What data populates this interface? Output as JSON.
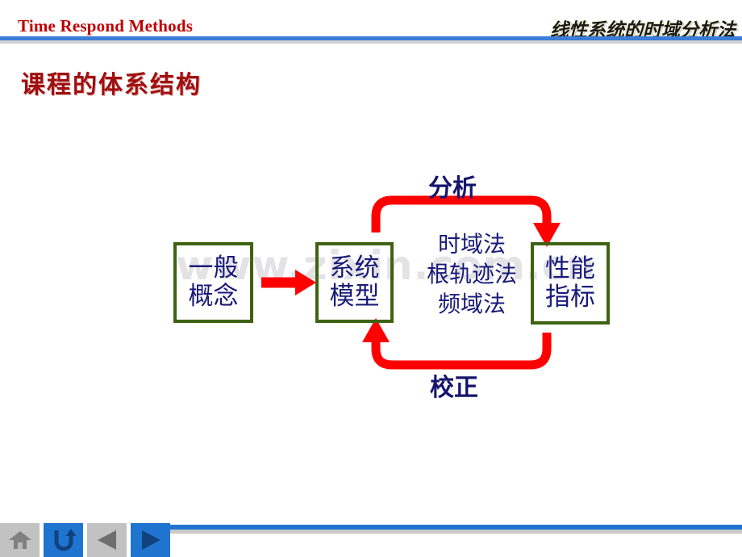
{
  "header": {
    "left_title": "Time Respond Methods",
    "right_title": "线性系统的时域分析法",
    "left_color": "#c00000",
    "rule_color": "#3b7dd8"
  },
  "slide": {
    "title": "课程的体系结构",
    "title_color": "#a01010",
    "watermark": "www.zixin.com.cn"
  },
  "diagram": {
    "node_border_color": "#3f6212",
    "node_text_color": "#1a1a7a",
    "arrow_color": "#ff0000",
    "nodes": [
      {
        "id": "concept",
        "line1": "一般",
        "line2": "概念"
      },
      {
        "id": "model",
        "line1": "系统",
        "line2": "模型"
      },
      {
        "id": "metric",
        "line1": "性能",
        "line2": "指标"
      }
    ],
    "methods": [
      "时域法",
      "根轨迹法",
      "频域法"
    ],
    "loop_labels": {
      "top": "分析",
      "bottom": "校正"
    }
  },
  "footer": {
    "bar_color": "#1f74d0",
    "buttons": [
      {
        "id": "home",
        "icon": "home-icon",
        "label": "Home"
      },
      {
        "id": "return",
        "icon": "return-arrow-icon",
        "label": "Return"
      },
      {
        "id": "prev",
        "icon": "triangle-left-icon",
        "label": "Previous"
      },
      {
        "id": "next",
        "icon": "triangle-right-icon",
        "label": "Next"
      }
    ]
  }
}
